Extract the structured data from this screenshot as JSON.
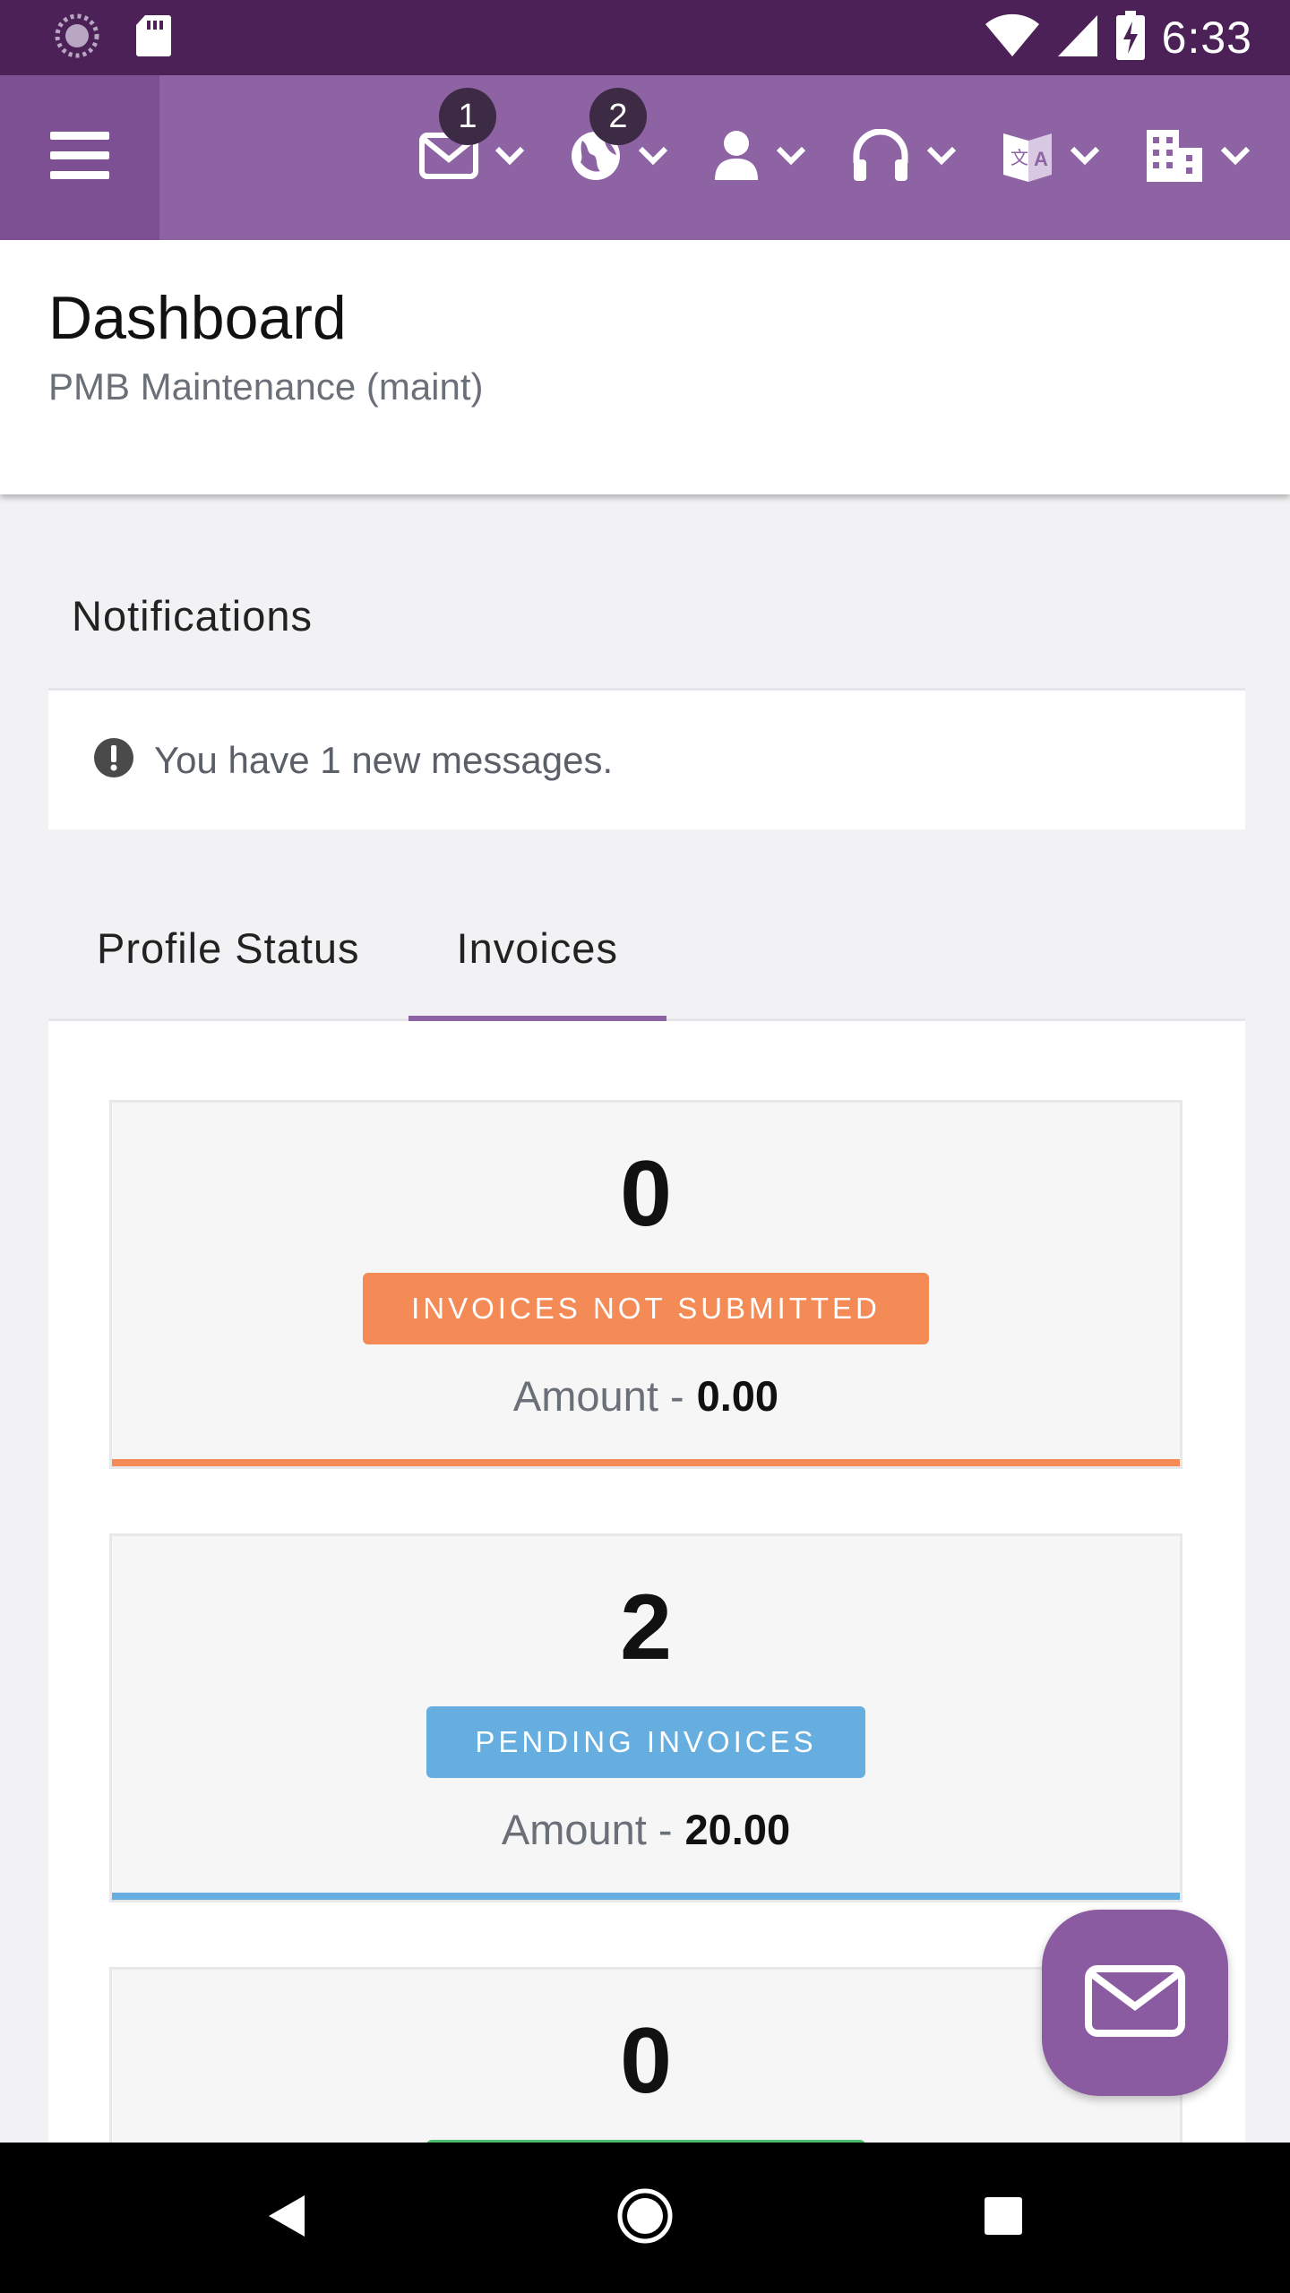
{
  "status_bar": {
    "time": "6:33",
    "icons": [
      "loading-icon",
      "sd-card-icon",
      "wifi-icon",
      "signal-icon",
      "battery-charging-icon"
    ]
  },
  "app_bar": {
    "menu_icon": "hamburger-menu-icon",
    "items": [
      {
        "icon": "mail-icon",
        "badge": "1"
      },
      {
        "icon": "globe-icon",
        "badge": "2"
      },
      {
        "icon": "user-icon"
      },
      {
        "icon": "headset-icon"
      },
      {
        "icon": "translate-icon"
      },
      {
        "icon": "building-icon"
      }
    ],
    "color": "#8e63a3",
    "status_color": "#4b2158"
  },
  "header": {
    "title": "Dashboard",
    "subtitle": "PMB Maintenance (maint)"
  },
  "notifications": {
    "heading": "Notifications",
    "message": "You have 1 new messages."
  },
  "tabs": [
    {
      "label": "Profile Status",
      "active": false
    },
    {
      "label": "Invoices",
      "active": true
    }
  ],
  "cards": [
    {
      "count": "0",
      "label": "INVOICES NOT SUBMITTED",
      "amount_label": "Amount -",
      "amount": "0.00",
      "color": "#f48a56"
    },
    {
      "count": "2",
      "label": "PENDING INVOICES",
      "amount_label": "Amount -",
      "amount": "20.00",
      "color": "#66aedf"
    },
    {
      "count": "0",
      "label": "",
      "amount_label": "",
      "amount": "",
      "color": "#4cbb6c"
    }
  ],
  "fab": {
    "icon": "envelope-icon"
  },
  "nav_bar": {
    "icons": [
      "back-icon",
      "home-icon",
      "recents-icon"
    ]
  }
}
